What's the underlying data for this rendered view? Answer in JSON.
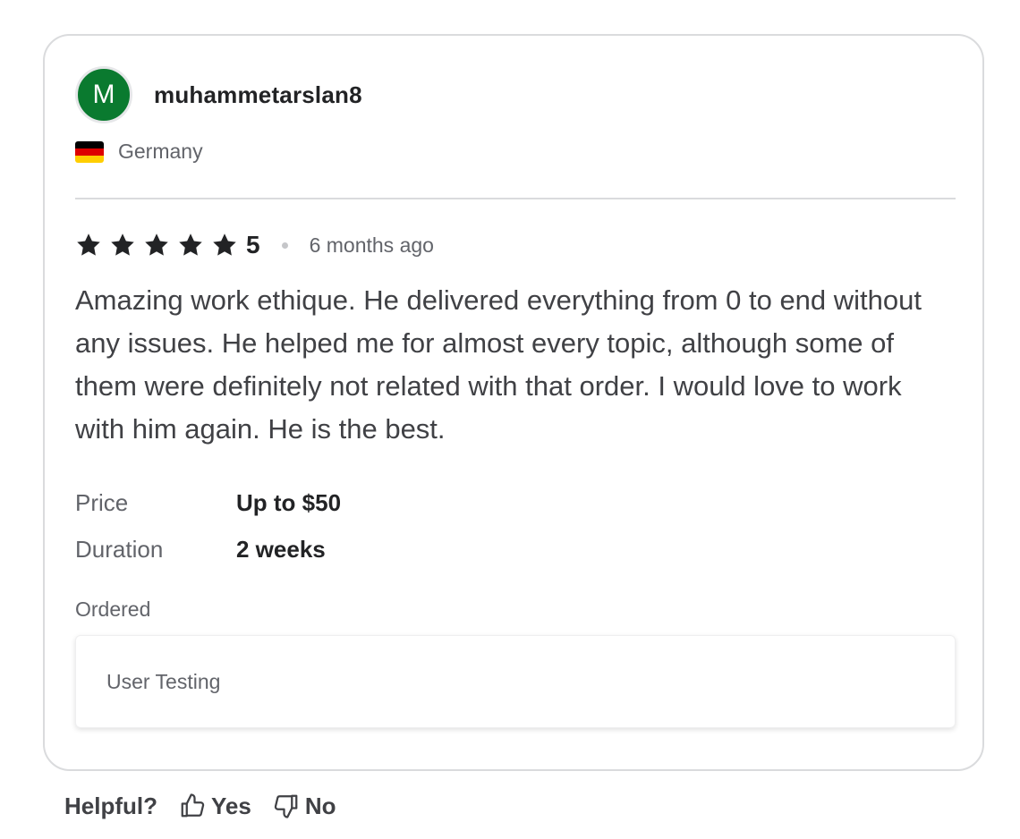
{
  "reviewer": {
    "avatar_letter": "M",
    "avatar_color": "#0a7a2f",
    "username": "muhammetarslan8",
    "country": "Germany",
    "flag_icon": "germany-flag-icon"
  },
  "rating": {
    "stars": 5,
    "max_stars": 5,
    "value": "5",
    "time_ago": "6 months ago"
  },
  "review": {
    "text": "Amazing work ethique. He delivered everything from 0 to end without any issues. He helped me for almost every topic, although some of them were definitely not related with that order. I would love to work with him again. He is the best."
  },
  "details": {
    "price_label": "Price",
    "price_value": "Up to $50",
    "duration_label": "Duration",
    "duration_value": "2 weeks"
  },
  "ordered": {
    "label": "Ordered",
    "item": "User Testing"
  },
  "helpful": {
    "label": "Helpful?",
    "yes_label": "Yes",
    "no_label": "No"
  }
}
